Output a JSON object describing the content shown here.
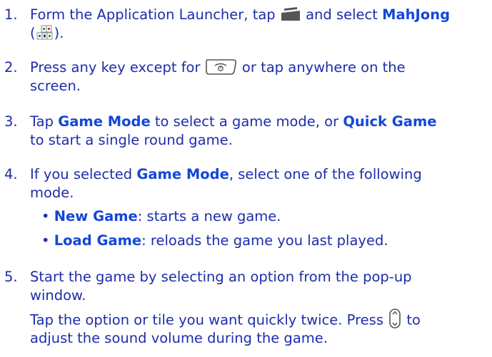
{
  "steps": [
    {
      "num": "1.",
      "l1a": "Form the Application Launcher, tap",
      "l1b": "and select",
      "l1c": "MahJong",
      "l2a": "(",
      "l2b": ")."
    },
    {
      "num": "2.",
      "l1a": "Press any key except for",
      "l1b": "or tap anywhere on the",
      "l2": "screen."
    },
    {
      "num": "3.",
      "l1a": "Tap",
      "l1b": "Game Mode",
      "l1c": "to select a game mode, or",
      "l1d": "Quick Game",
      "l2": "to start a single round game."
    },
    {
      "num": "4.",
      "l1a": "If you selected",
      "l1b": "Game Mode",
      "l1c": ", select one of the following",
      "l2": "mode.",
      "bullets": [
        {
          "term": "New Game",
          "desc": ": starts a new game."
        },
        {
          "term": "Load Game",
          "desc": ": reloads the game you last played."
        }
      ]
    },
    {
      "num": "5.",
      "l1": "Start the game by selecting an option from the pop-up",
      "l2": "window.",
      "p1a": "Tap the option or tile you want quickly twice. Press",
      "p1b": "to",
      "p2": "adjust the sound volume during the game."
    }
  ],
  "bullet_char": "•",
  "icons": [
    "start-menu-icon",
    "mahjong-app-icon",
    "end-key-icon",
    "volume-key-icon"
  ],
  "colors": {
    "text": "#1d2dab",
    "bold": "#1447d8",
    "icon": "#555555"
  }
}
